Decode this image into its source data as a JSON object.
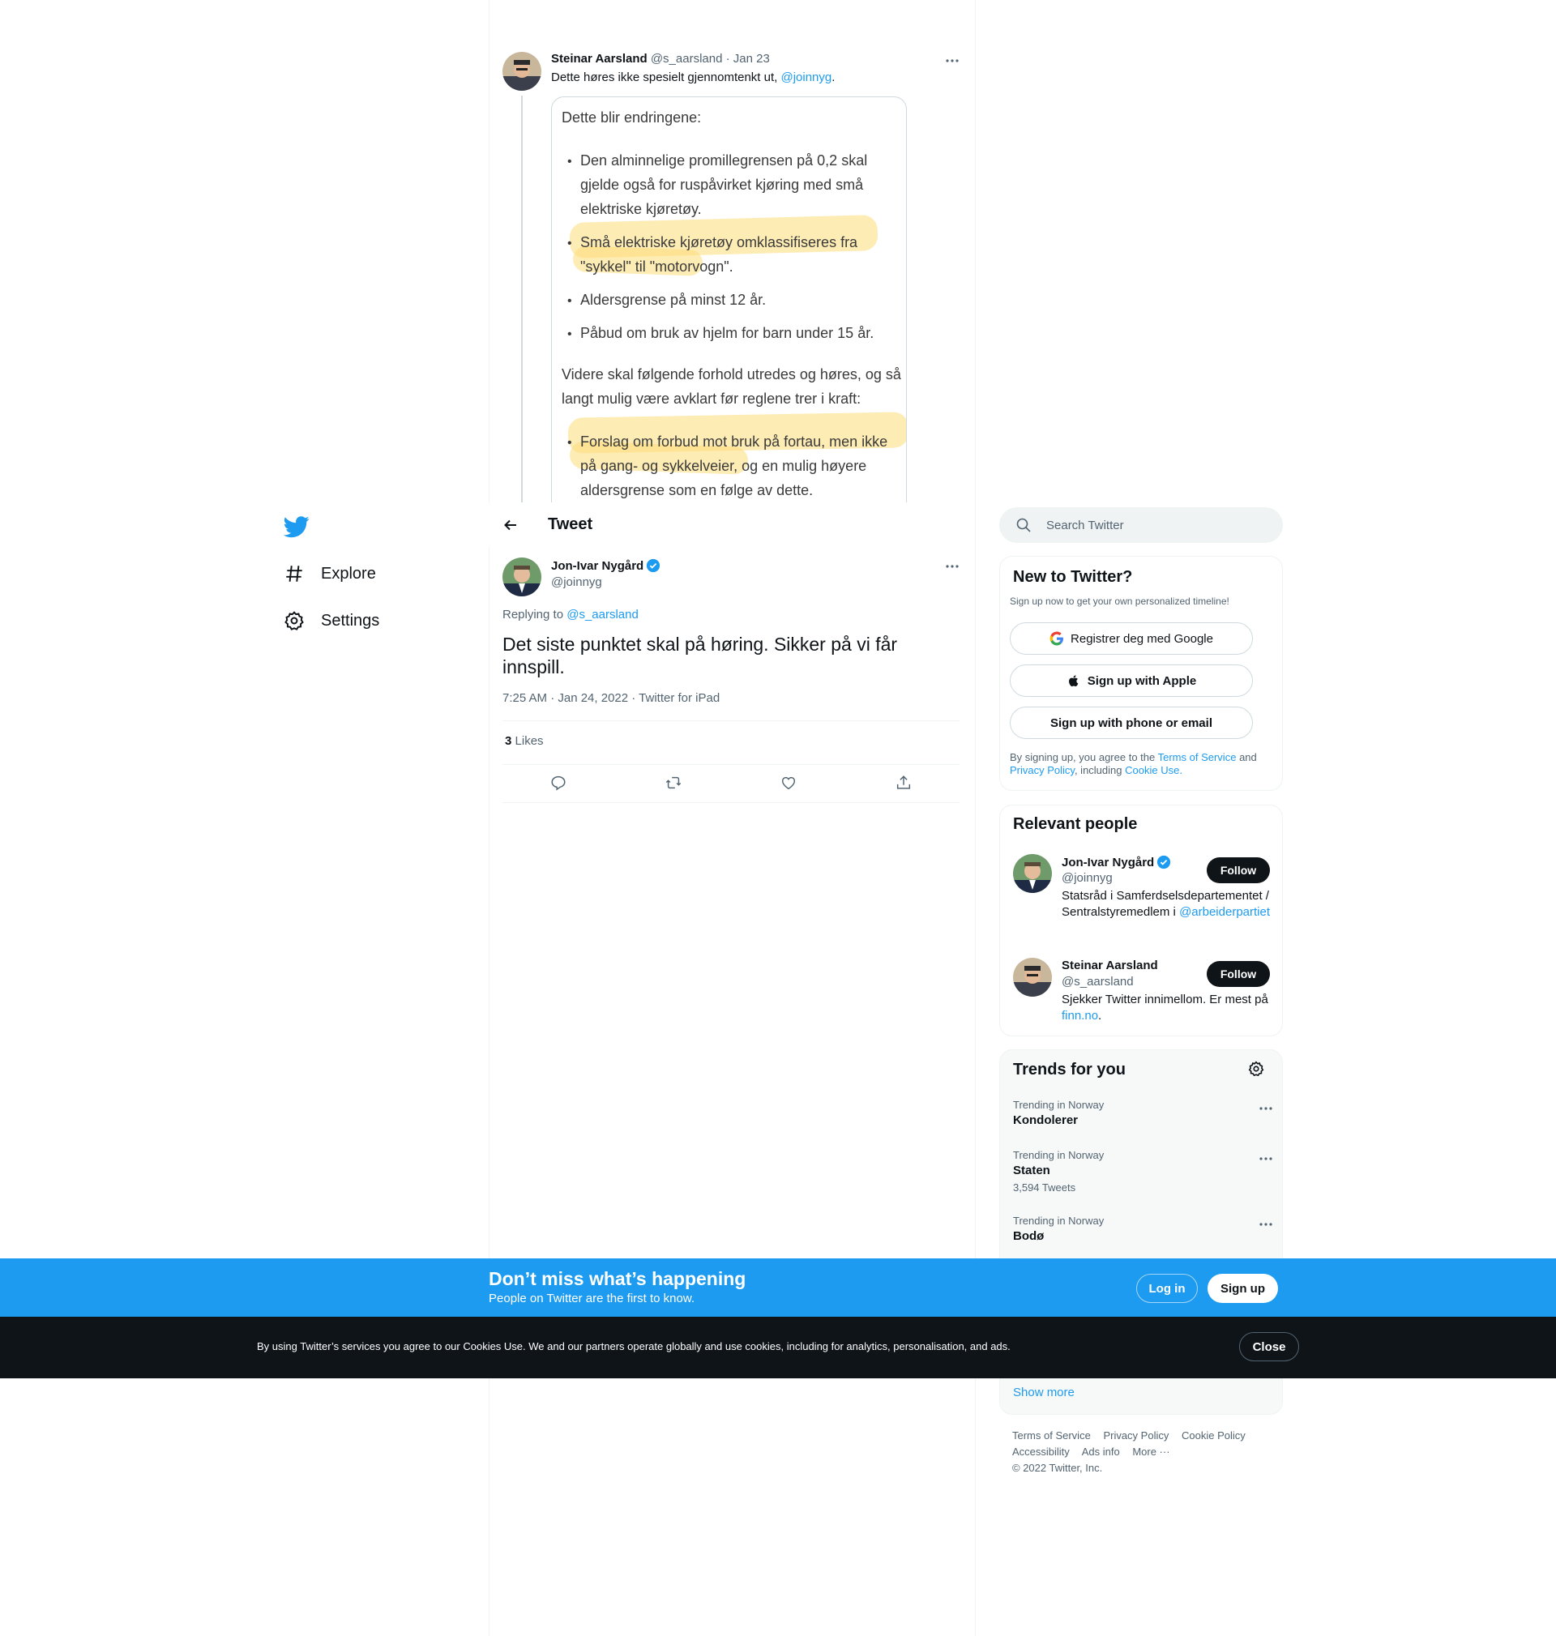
{
  "nav": {
    "explore": "Explore",
    "settings": "Settings"
  },
  "parent_tweet": {
    "author_name": "Steinar Aarsland",
    "author_handle": "@s_aarsland",
    "separator": "·",
    "date": "Jan 23",
    "text": "Dette høres ikke spesielt gjennomtenkt ut,",
    "mention": "@joinnyg",
    "text_end": ".",
    "quote_image": {
      "intro": "Dette blir endringene:",
      "bullets_1": [
        "Den alminnelige promillegrensen på 0,2 skal gjelde også for ruspåvirket kjøring med små elektriske kjøretøy.",
        "Små elektriske kjøretøy omklassifiseres fra \"sykkel\" til \"motorvogn\".",
        "Aldersgrense på minst 12 år.",
        "Påbud om bruk av hjelm for barn under 15 år."
      ],
      "middle": "Videre skal følgende forhold utredes og høres, og så langt mulig være avklart før reglene trer i kraft:",
      "bullets_2": [
        "Forslag om forbud mot bruk på fortau, men ikke på gang- og sykkelveier, og en mulig høyere aldersgrense som en følge av dette."
      ],
      "bullet_glyph": "•"
    }
  },
  "header": {
    "title": "Tweet"
  },
  "main_tweet": {
    "author_name": "Jon-Ivar Nygård",
    "author_handle": "@joinnyg",
    "replying_label": "Replying to",
    "replying_handle": "@s_aarsland",
    "text": "Det siste punktet skal på høring. Sikker på vi får innspill.",
    "meta": "7:25 AM · Jan 24, 2022 · Twitter for iPad",
    "likes_count": "3",
    "likes_label": "Likes"
  },
  "sidebar": {
    "search_placeholder": "Search Twitter",
    "new_to_twitter": {
      "title": "New to Twitter?",
      "subtitle": "Sign up now to get your own personalized timeline!",
      "google_btn": "Registrer deg med Google",
      "apple_btn": "Sign up with Apple",
      "phone_btn": "Sign up with phone or email",
      "legal_1": "By signing up, you agree to the",
      "terms": "Terms of Service",
      "legal_and": "and",
      "privacy": "Privacy Policy",
      "legal_including": ", including",
      "cookie_use": "Cookie Use",
      "legal_end": "."
    },
    "relevant_people": {
      "title": "Relevant people",
      "follow_label": "Follow",
      "people": [
        {
          "name": "Jon-Ivar Nygård",
          "handle": "@joinnyg",
          "bio": "Statsråd i Samferdselsdepartementet / Sentralstyremedlem i",
          "bio_link": "@arbeiderpartiet"
        },
        {
          "name": "Steinar Aarsland",
          "handle": "@s_aarsland",
          "bio": "Sjekker Twitter innimellom. Er mest på",
          "bio_link": "finn.no",
          "bio_end": "."
        }
      ]
    },
    "trends": {
      "title": "Trends for you",
      "items": [
        {
          "category": "Trending in Norway",
          "name": "Kondolerer"
        },
        {
          "category": "Trending in Norway",
          "name": "Staten",
          "count": "3,594 Tweets"
        },
        {
          "category": "Trending in Norway",
          "name": "Bodø"
        }
      ],
      "show_more": "Show more"
    },
    "footer": {
      "links_row1": [
        "Terms of Service",
        "Privacy Policy",
        "Cookie Policy"
      ],
      "links_row2": [
        "Accessibility",
        "Ads info",
        "More ···"
      ],
      "copyright": "© 2022 Twitter, Inc."
    }
  },
  "banner": {
    "title": "Don’t miss what’s happening",
    "subtitle": "People on Twitter are the first to know.",
    "login": "Log in",
    "signup": "Sign up"
  },
  "cookie_bar": {
    "text": "By using Twitter’s services you agree to our Cookies Use. We and our partners operate globally and use cookies, including for analytics, personalisation, and ads.",
    "close": "Close"
  },
  "colors": {
    "brand": "#1d9bf0",
    "text": "#0f1419",
    "muted": "#536471",
    "highlight": "#fddc78"
  }
}
